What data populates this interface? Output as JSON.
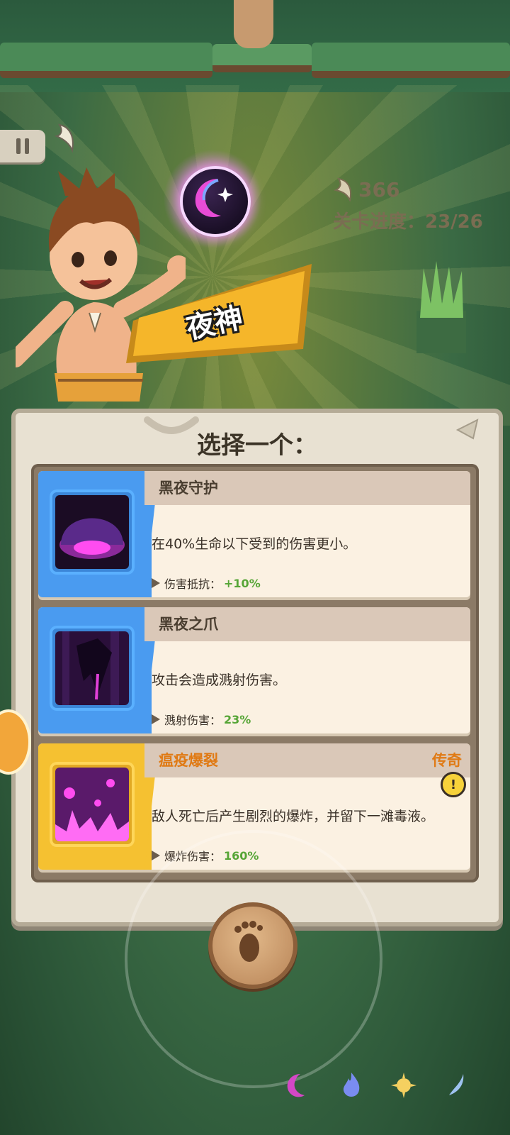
{
  "hud": {
    "coins": "366",
    "stage_progress": "关卡进度：23/26"
  },
  "reward": {
    "name": "夜神",
    "icon": "crescent-moon-orb-icon"
  },
  "panel": {
    "title": "选择一个：",
    "cards": [
      {
        "name": "黑夜守护",
        "rarity": "",
        "description": "在40%生命以下受到的伤害更小。",
        "stat_label": "伤害抵抗：",
        "stat_value": "+10%",
        "theme": "blue",
        "icon": "dark-shield-dome-icon"
      },
      {
        "name": "黑夜之爪",
        "rarity": "",
        "description": "攻击会造成溅射伤害。",
        "stat_label": "溅射伤害：",
        "stat_value": "23%",
        "theme": "blue",
        "icon": "dark-claw-icon"
      },
      {
        "name": "瘟疫爆裂",
        "rarity": "传奇",
        "description": "敌人死亡后产生剧烈的爆炸，并留下一滩毒液。",
        "stat_label": "爆炸伤害：",
        "stat_value": "160%",
        "theme": "gold",
        "icon": "plague-burst-icon"
      }
    ]
  },
  "controls": {
    "joystick_icon": "footprint-icon",
    "pause_icon": "pause-icon"
  },
  "skills": [
    {
      "icon": "moon-skill-icon"
    },
    {
      "icon": "flame-skill-icon"
    },
    {
      "icon": "sun-skill-icon"
    },
    {
      "icon": "wind-skill-icon"
    }
  ],
  "colors": {
    "rarity_legendary": "#e07a14",
    "stat_value": "#56a536",
    "banner": "#f5b62a"
  }
}
